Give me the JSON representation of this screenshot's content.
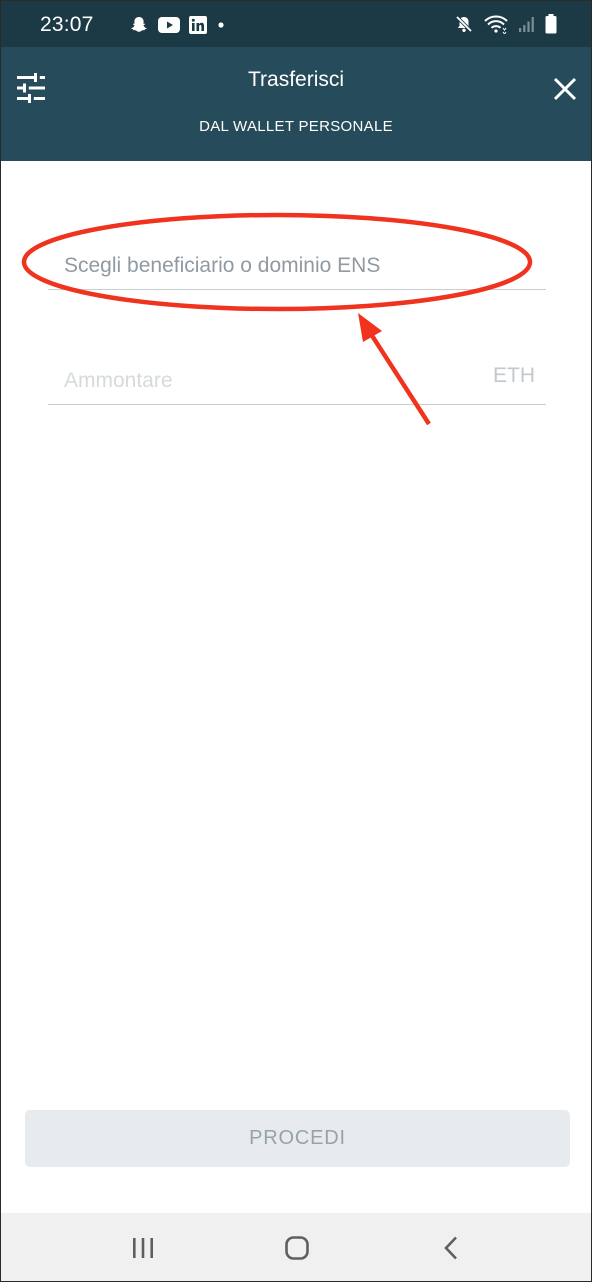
{
  "status_bar": {
    "time": "23:07",
    "left_icons": [
      "snapchat-icon",
      "youtube-icon",
      "linkedin-icon",
      "notification-dot-icon"
    ],
    "right_icons": [
      "mute-icon",
      "wifi-icon",
      "signal-icon",
      "battery-icon"
    ]
  },
  "header": {
    "title": "Trasferisci",
    "subtitle": "DAL WALLET PERSONALE",
    "left_icon": "tune-icon",
    "right_icon": "close-icon"
  },
  "form": {
    "beneficiary": {
      "value": "",
      "placeholder": "Scegli beneficiario o dominio ENS"
    },
    "amount": {
      "value": "",
      "placeholder": "Ammontare",
      "unit": "ETH"
    }
  },
  "annotation": {
    "shapes": [
      "red-ellipse",
      "red-arrow"
    ],
    "color": "#f0331e"
  },
  "actions": {
    "proceed_label": "PROCEDI"
  },
  "nav_bar": {
    "icons": [
      "recent-apps-icon",
      "home-icon",
      "back-icon"
    ]
  },
  "colors": {
    "status_bar": "#1c3a46",
    "header": "#264b5a",
    "button_bg": "#e7ebed",
    "button_text": "#97a3ab",
    "annotation": "#f0331e"
  }
}
